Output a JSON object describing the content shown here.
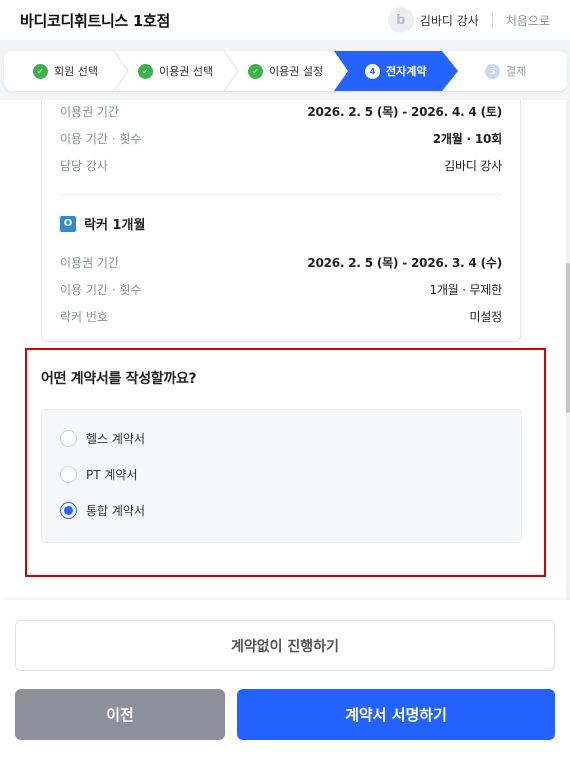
{
  "header": {
    "title": "바디코디휘트니스 1호점",
    "avatar_letter": "b",
    "teacher": "김바디 강사",
    "restart": "처음으로"
  },
  "steps": [
    {
      "num": "✓",
      "label": "회원 선택",
      "state": "done"
    },
    {
      "num": "✓",
      "label": "이용권 선택",
      "state": "done"
    },
    {
      "num": "✓",
      "label": "이용권 설정",
      "state": "done"
    },
    {
      "num": "4",
      "label": "전자계약",
      "state": "current"
    },
    {
      "num": "5",
      "label": "결제",
      "state": "todo"
    }
  ],
  "pass1": {
    "period_label": "이용권 기간",
    "period_value": "2026. 2. 5 (목) - 2026. 4. 4 (토)",
    "usage_label": "이용 기간 · 횟수",
    "usage_value": "2개월 · 10회",
    "coach_label": "담당 강사",
    "coach_value": "김바디 강사"
  },
  "locker": {
    "badge": "O",
    "title": "락커 1개월",
    "period_label": "이용권 기간",
    "period_value": "2026. 2. 5 (목) - 2026. 3. 4 (수)",
    "usage_label": "이용 기간 · 횟수",
    "usage_value": "1개월 · 무제한",
    "number_label": "락커 번호",
    "number_value": "미설정"
  },
  "contract": {
    "question": "어떤 계약서를 작성할까요?",
    "options": [
      {
        "label": "헬스 계약서",
        "selected": false
      },
      {
        "label": "PT 계약서",
        "selected": false
      },
      {
        "label": "통합 계약서",
        "selected": true
      }
    ]
  },
  "buttons": {
    "skip": "계약없이 진행하기",
    "prev": "이전",
    "sign": "계약서 서명하기"
  },
  "colors": {
    "primary": "#2563ff",
    "done": "#3bb34a",
    "highlight": "#d80000"
  }
}
